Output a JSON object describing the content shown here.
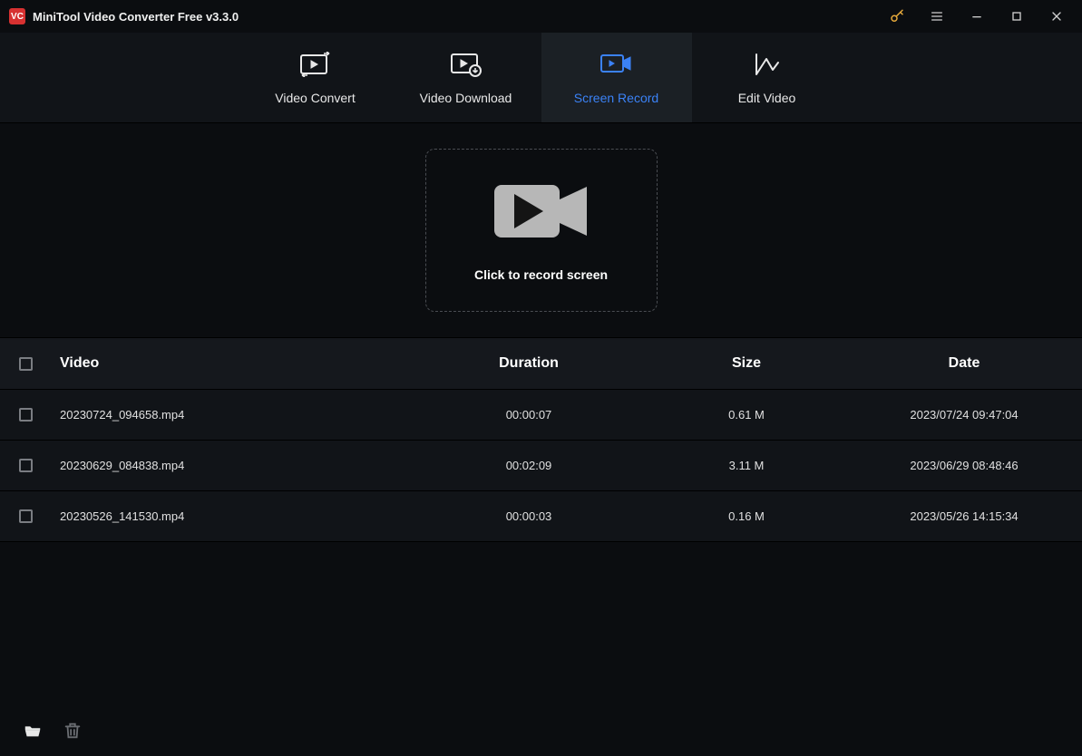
{
  "window": {
    "title": "MiniTool Video Converter Free v3.3.0"
  },
  "tabs": {
    "video_convert": "Video Convert",
    "video_download": "Video Download",
    "screen_record": "Screen Record",
    "edit_video": "Edit Video",
    "active": "screen_record"
  },
  "record": {
    "label": "Click to record screen"
  },
  "table": {
    "headers": {
      "video": "Video",
      "duration": "Duration",
      "size": "Size",
      "date": "Date"
    },
    "rows": [
      {
        "video": "20230724_094658.mp4",
        "duration": "00:00:07",
        "size": "0.61 M",
        "date": "2023/07/24 09:47:04"
      },
      {
        "video": "20230629_084838.mp4",
        "duration": "00:02:09",
        "size": "3.11 M",
        "date": "2023/06/29 08:48:46"
      },
      {
        "video": "20230526_141530.mp4",
        "duration": "00:00:03",
        "size": "0.16 M",
        "date": "2023/05/26 14:15:34"
      }
    ]
  }
}
